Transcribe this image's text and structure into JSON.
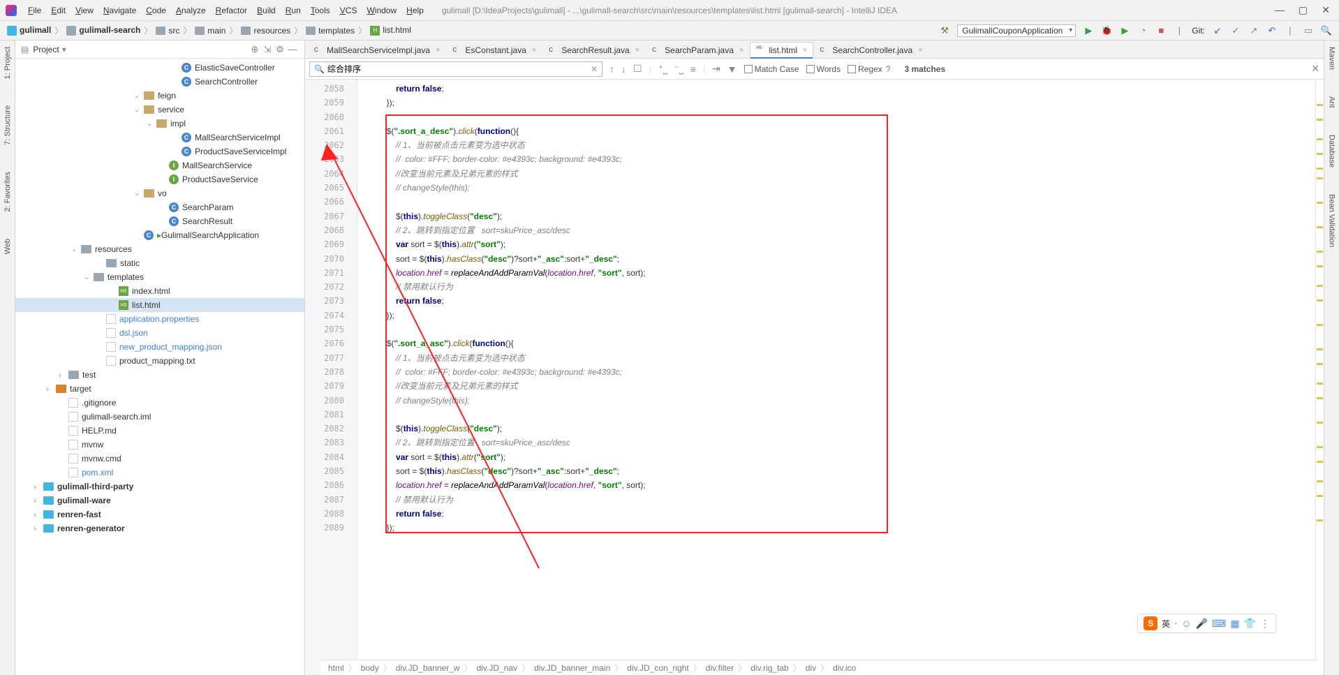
{
  "window": {
    "title": "gulimall [D:\\IdeaProjects\\gulimall] - ...\\gulimall-search\\src\\main\\resources\\templates\\list.html [gulimall-search] - IntelliJ IDEA"
  },
  "menus": [
    "File",
    "Edit",
    "View",
    "Navigate",
    "Code",
    "Analyze",
    "Refactor",
    "Build",
    "Run",
    "Tools",
    "VCS",
    "Window",
    "Help"
  ],
  "breadcrumb_nav": [
    "gulimall",
    "gulimall-search",
    "src",
    "main",
    "resources",
    "templates",
    "list.html"
  ],
  "run_config": "GulimallCouponApplication",
  "git_label": "Git:",
  "proj_header": "Project",
  "tree": [
    {
      "indent": 12,
      "ic": "cls",
      "label": "ElasticSaveController"
    },
    {
      "indent": 12,
      "ic": "cls",
      "label": "SearchController"
    },
    {
      "indent": 9,
      "arr": "open",
      "ic": "fold",
      "label": "feign"
    },
    {
      "indent": 9,
      "arr": "open",
      "ic": "fold",
      "label": "service"
    },
    {
      "indent": 10,
      "arr": "open",
      "ic": "fold",
      "label": "impl"
    },
    {
      "indent": 12,
      "ic": "cls",
      "label": "MallSearchServiceImpl"
    },
    {
      "indent": 12,
      "ic": "cls",
      "label": "ProductSaveServiceImpl"
    },
    {
      "indent": 11,
      "ic": "int",
      "label": "MallSearchService"
    },
    {
      "indent": 11,
      "ic": "int",
      "label": "ProductSaveService"
    },
    {
      "indent": 9,
      "arr": "open",
      "ic": "fold",
      "label": "vo"
    },
    {
      "indent": 11,
      "ic": "cls",
      "label": "SearchParam"
    },
    {
      "indent": 11,
      "ic": "cls",
      "label": "SearchResult"
    },
    {
      "indent": 9,
      "ic": "cls",
      "label": "GulimallSearchApplication",
      "run": true
    },
    {
      "indent": 4,
      "arr": "open",
      "ic": "foldg",
      "label": "resources"
    },
    {
      "indent": 6,
      "ic": "foldg",
      "label": "static"
    },
    {
      "indent": 5,
      "arr": "open",
      "ic": "foldg",
      "label": "templates"
    },
    {
      "indent": 7,
      "ic": "html",
      "label": "index.html"
    },
    {
      "indent": 7,
      "ic": "html",
      "label": "list.html",
      "sel": true
    },
    {
      "indent": 6,
      "ic": "pfile",
      "label": "application.properties",
      "link": true
    },
    {
      "indent": 6,
      "ic": "pfile",
      "label": "dsl.json",
      "link": true
    },
    {
      "indent": 6,
      "ic": "pfile",
      "label": "new_product_mapping.json",
      "link": true
    },
    {
      "indent": 6,
      "ic": "pfile",
      "label": "product_mapping.txt"
    },
    {
      "indent": 3,
      "arr": "closed",
      "ic": "foldg",
      "label": "test"
    },
    {
      "indent": 2,
      "arr": "closed",
      "ic": "foldt",
      "label": "target"
    },
    {
      "indent": 3,
      "ic": "pfile",
      "label": ".gitignore"
    },
    {
      "indent": 3,
      "ic": "pfile",
      "label": "gulimall-search.iml"
    },
    {
      "indent": 3,
      "ic": "pfile",
      "label": "HELP.md"
    },
    {
      "indent": 3,
      "ic": "pfile",
      "label": "mvnw"
    },
    {
      "indent": 3,
      "ic": "pfile",
      "label": "mvnw.cmd"
    },
    {
      "indent": 3,
      "ic": "pfile",
      "label": "pom.xml",
      "link": true
    },
    {
      "indent": 1,
      "arr": "closed",
      "ic": "mod",
      "label": "gulimall-third-party",
      "bold": true
    },
    {
      "indent": 1,
      "arr": "closed",
      "ic": "mod",
      "label": "gulimall-ware",
      "bold": true
    },
    {
      "indent": 1,
      "arr": "closed",
      "ic": "mod",
      "label": "renren-fast",
      "bold": true
    },
    {
      "indent": 1,
      "arr": "closed",
      "ic": "mod",
      "label": "renren-generator",
      "bold": true
    }
  ],
  "tabs": [
    {
      "ic": "cls",
      "label": "MallSearchServiceImpl.java"
    },
    {
      "ic": "cls",
      "label": "EsConstant.java"
    },
    {
      "ic": "cls",
      "label": "SearchResult.java"
    },
    {
      "ic": "cls",
      "label": "SearchParam.java"
    },
    {
      "ic": "html",
      "label": "list.html",
      "active": true
    },
    {
      "ic": "cls",
      "label": "SearchController.java"
    }
  ],
  "find": {
    "query": "综合排序",
    "matches": "3 matches",
    "match_case": "Match Case",
    "words": "Words",
    "regex": "Regex"
  },
  "line_start": 2058,
  "line_end": 2089,
  "code_lines": [
    "            <span class='kw'>return false</span>;",
    "        });",
    "",
    "        $(<span class='str'>\".sort_a_desc\"</span>).<span class='fn'>click</span>(<span class='kw'>function</span>(){",
    "            <span class='cmt'>// 1、当前被点击元素变为选中状态</span>",
    "            <span class='cmt'>//  color: #FFF; border-color: #e4393c; background: #e4393c;</span>",
    "            <span class='cmt'>//改变当前元素及兄弟元素的样式</span>",
    "            <span class='cmt'>// changeStyle(this);</span>",
    "",
    "            $(<span class='kw'>this</span>).<span class='fn'>toggleClass</span>(<span class='str'>\"desc\"</span>);",
    "            <span class='cmt'>// 2、跳转到指定位置   sort=skuPrice_asc/desc</span>",
    "            <span class='kw'>var </span>sort = $(<span class='kw'>this</span>).<span class='fn'>attr</span>(<span class='str'>\"sort\"</span>);",
    "            sort = $(<span class='kw'>this</span>).<span class='fn'>hasClass</span>(<span class='str'>\"desc\"</span>)?sort+<span class='str'>\"_asc\"</span>:sort+<span class='str'>\"_desc\"</span>;",
    "            <span class='glob'>location</span>.<span class='glob'>href</span> = <span class='fn2'>replaceAndAddParamVal</span>(<span class='glob'>location</span>.<span class='glob'>href</span>, <span class='str'>\"sort\"</span>, sort);",
    "            <span class='cmt'>// 禁用默认行为</span>",
    "            <span class='kw'>return false</span>;",
    "        });",
    "",
    "        $(<span class='str'>\".sort_a_asc\"</span>).<span class='fn'>click</span>(<span class='kw'>function</span>(){",
    "            <span class='cmt'>// 1、当前被点击元素变为选中状态</span>",
    "            <span class='cmt'>//  color: #FFF; border-color: #e4393c; background: #e4393c;</span>",
    "            <span class='cmt'>//改变当前元素及兄弟元素的样式</span>",
    "            <span class='cmt'>// changeStyle(this);</span>",
    "",
    "            $(<span class='kw'>this</span>).<span class='fn'>toggleClass</span>(<span class='str'>\"desc\"</span>);",
    "            <span class='cmt'>// 2、跳转到指定位置   sort=skuPrice_asc/desc</span>",
    "            <span class='kw'>var </span>sort = $(<span class='kw'>this</span>).<span class='fn'>attr</span>(<span class='str'>\"sort\"</span>);",
    "            sort = $(<span class='kw'>this</span>).<span class='fn'>hasClass</span>(<span class='str'>\"desc\"</span>)?sort+<span class='str'>\"_asc\"</span>:sort+<span class='str'>\"_desc\"</span>;",
    "            <span class='glob'>location</span>.<span class='glob'>href</span> = <span class='fn2'>replaceAndAddParamVal</span>(<span class='glob'>location</span>.<span class='glob'>href</span>, <span class='str'>\"sort\"</span>, sort);",
    "            <span class='cmt'>// 禁用默认行为</span>",
    "            <span class='kw'>return false</span>;",
    "        });"
  ],
  "bottom_crumbs": [
    "html",
    "body",
    "div.JD_banner_w",
    "div.JD_nav",
    "div.JD_banner_main",
    "div.JD_con_right",
    "div.filter",
    "div.rig_tab",
    "div",
    "div.ico"
  ],
  "left_tabs": [
    "1: Project",
    "7: Structure",
    "2: Favorites",
    "Web"
  ],
  "right_tabs": [
    "Maven",
    "Ant",
    "Database",
    "Bean Validation"
  ],
  "ime_label": "英"
}
